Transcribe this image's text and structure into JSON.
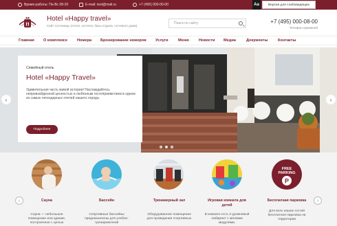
{
  "topbar": {
    "hours": "Время работы: Пн-Вс 08-20",
    "email": "E-mail: test@mail.ru",
    "phone": "+7 (495) 000-00-00",
    "font_toggle": "Aa",
    "vision_version": "Версия для слабовидящих",
    "bg_color": "#7a1f2b"
  },
  "header": {
    "title": "Hotel «Happy travel»",
    "subtitle": "Сайт гостиницы (отеля, хостела, базы отдыха, гостевого дома)",
    "search_placeholder": "Поиск по сайту",
    "phone": "+7 (495) 000-08-00",
    "phone_caption": "Телефон приемной"
  },
  "nav": {
    "items": [
      "Главная",
      "О комплексе",
      "Номера",
      "Бронирование номеров",
      "Услуги",
      "Меню",
      "Новости",
      "Медиа",
      "Документы",
      "Контакты"
    ]
  },
  "hero": {
    "kicker": "Семейный отель",
    "title": "Hotel «Happy Travel»",
    "text": "Удивительная часть живой истории! Наслаждайтесь непревзойденной ценностью и любезным гостеприимством в одном из самых легендарных отелей нашего города.",
    "button": "Подробнее",
    "prev_icon": "‹",
    "next_icon": "›",
    "slides": 3,
    "active_slide": 1
  },
  "services": [
    {
      "title": "Сауна",
      "text": "Сауна — небольшое помещение или здание, построенное с целью",
      "icon": "sauna-photo"
    },
    {
      "title": "Бассейн",
      "text": "Спортивные бассейны предназначены для учебно-тренировочной",
      "icon": "pool-photo"
    },
    {
      "title": "Тренажерный зал",
      "text": "Оборудованное помещение для проведения спортивных",
      "icon": "gym-photo"
    },
    {
      "title": "Игровая комната для детей",
      "text": "В комнате есть 2-уровневый лабиринт с мягкими модулями,",
      "icon": "playroom-photo"
    },
    {
      "title": "Бесплатная парковка",
      "text": "Для всех наших гостей бесплатная парковка на территории",
      "icon": "parking-sign"
    }
  ],
  "parking_sign": {
    "line1": "FREE",
    "line2": "PARKING",
    "letter": "P"
  },
  "colors": {
    "accent": "#7a1f2b",
    "services_bg": "#f3f3f3"
  }
}
